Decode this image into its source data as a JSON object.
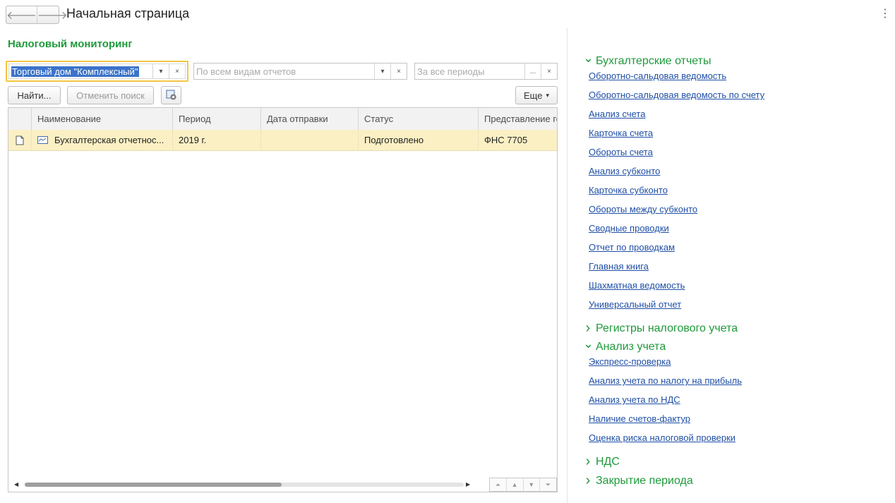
{
  "header": {
    "back_icon": "arrow-left-icon",
    "forward_icon": "arrow-right-icon",
    "title": "Начальная страница",
    "menu_icon": "more-vertical-icon"
  },
  "section": {
    "title": "Налоговый мониторинг"
  },
  "filters": {
    "organization": "Торговый дом \"Комплексный\"",
    "report_type_placeholder": "По всем видам отчетов",
    "period_placeholder": "За все периоды",
    "choose_label": "...",
    "clear_label": "×",
    "dropdown_label": "▾"
  },
  "toolbar": {
    "find_label": "Найти...",
    "cancel_search_label": "Отменить поиск",
    "more_label": "Еще"
  },
  "table": {
    "columns": [
      "Наименование",
      "Период",
      "Дата отправки",
      "Статус",
      "Представление го"
    ],
    "rows": [
      {
        "name": "Бухгалтерская отчетнос...",
        "period": "2019 г.",
        "sent_date": "",
        "status": "Подготовлено",
        "representation": "ФНС 7705"
      }
    ]
  },
  "panel": {
    "groups": [
      {
        "title": "Бухгалтерские отчеты",
        "expanded": true,
        "items": [
          "Оборотно-сальдовая ведомость",
          "Оборотно-сальдовая ведомость по счету",
          "Анализ счета",
          "Карточка счета",
          "Обороты счета",
          "Анализ субконто",
          "Карточка субконто",
          "Обороты между субконто",
          "Сводные проводки",
          "Отчет по проводкам",
          "Главная книга",
          "Шахматная ведомость",
          "Универсальный отчет"
        ]
      },
      {
        "title": "Регистры налогового учета",
        "expanded": false,
        "items": []
      },
      {
        "title": "Анализ учета",
        "expanded": true,
        "items": [
          "Экспресс-проверка",
          "Анализ учета по налогу на прибыль",
          "Анализ учета по НДС",
          "Наличие счетов-фактур",
          "Оценка риска налоговой проверки"
        ]
      },
      {
        "title": "НДС",
        "expanded": false,
        "items": []
      },
      {
        "title": "Закрытие периода",
        "expanded": false,
        "items": []
      }
    ]
  },
  "colors": {
    "accent_green": "#1e9a3b",
    "link_blue": "#1f4fa6",
    "row_highlight": "#fbf0c4",
    "focus_border": "#f4c542"
  }
}
